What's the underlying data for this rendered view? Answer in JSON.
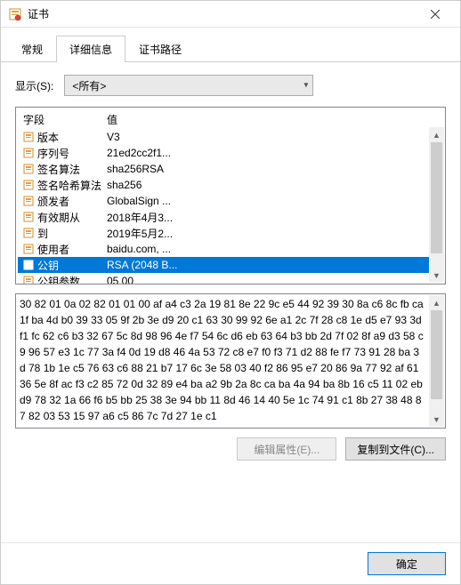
{
  "window": {
    "title": "证书"
  },
  "tabs": {
    "general": "常规",
    "details": "详细信息",
    "path": "证书路径"
  },
  "show": {
    "label": "显示(S):",
    "value": "<所有>"
  },
  "columns": {
    "field": "字段",
    "value": "值"
  },
  "rows": [
    {
      "field": "版本",
      "value": "V3",
      "selected": false
    },
    {
      "field": "序列号",
      "value": "21ed2cc2f1...",
      "selected": false
    },
    {
      "field": "签名算法",
      "value": "sha256RSA",
      "selected": false
    },
    {
      "field": "签名哈希算法",
      "value": "sha256",
      "selected": false
    },
    {
      "field": "颁发者",
      "value": "GlobalSign ...",
      "selected": false
    },
    {
      "field": "有效期从",
      "value": "2018年4月3...",
      "selected": false
    },
    {
      "field": "到",
      "value": "2019年5月2...",
      "selected": false
    },
    {
      "field": "使用者",
      "value": "baidu.com, ...",
      "selected": false
    },
    {
      "field": "公钥",
      "value": "RSA (2048 B...",
      "selected": true
    },
    {
      "field": "公钥参数",
      "value": "05 00",
      "selected": false
    }
  ],
  "detail_text": "30 82 01 0a 02 82 01 01 00 af a4 c3 2a 19 81 8e 22 9c e5 44 92 39 30 8a c6 8c fb ca 1f ba 4d b0 39 33 05 9f 2b 3e d9 20 c1 63 30 99 92 6e a1 2c 7f 28 c8 1e d5 e7 93 3d f1 fc 62 c6 b3 32 67 5c 8d 98 96 4e f7 54 6c d6 eb 63 64 b3 bb 2d 7f 02 8f a9 d3 58 c9 96 57 e3 1c 77 3a f4 0d 19 d8 46 4a 53 72 c8 e7 f0 f3 71 d2 88 fe f7 73 91 28 ba 3d 78 1b 1e c5 76 63 c6 88 21 b7 17 6c 3e 58 03 40 f2 86 95 e7 20 86 9a 77 92 af 61 36 5e 8f ac f3 c2 85 72 0d 32 89 e4 ba a2 9b 2a 8c ca ba 4a 94 ba 8b 16 c5 11 02 eb d9 78 32 1a 66 f6 b5 bb 25 38 3e 94 bb 11 8d 46 14 40 5e 1c 74 91 c1 8b 27 38 48 87 82 03 53 15 97 a6 c5 86 7c 7d 27 1e c1",
  "buttons": {
    "edit_props": "编辑属性(E)...",
    "copy_to_file": "复制到文件(C)...",
    "ok": "确定"
  }
}
